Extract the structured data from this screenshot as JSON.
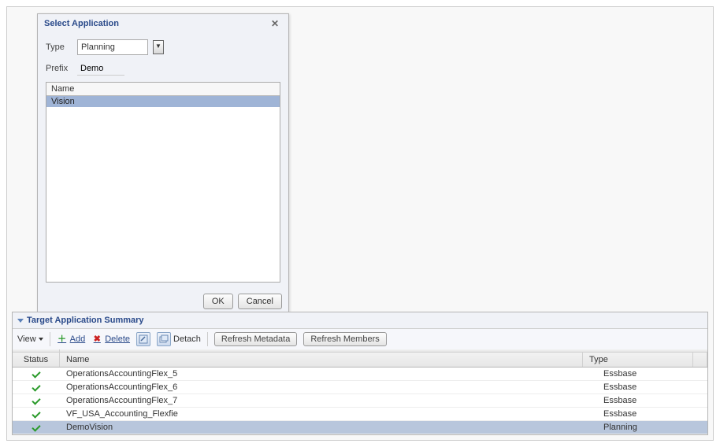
{
  "dialog": {
    "title": "Select Application",
    "type_label": "Type",
    "type_value": "Planning",
    "prefix_label": "Prefix",
    "prefix_value": "Demo",
    "list_header": "Name",
    "items": [
      "Vision"
    ],
    "ok_label": "OK",
    "cancel_label": "Cancel"
  },
  "summary": {
    "title": "Target Application Summary",
    "toolbar": {
      "view": "View",
      "add": "Add",
      "delete": "Delete",
      "detach": "Detach",
      "refresh_metadata": "Refresh Metadata",
      "refresh_members": "Refresh Members"
    },
    "columns": {
      "status": "Status",
      "name": "Name",
      "type": "Type"
    },
    "rows": [
      {
        "name": "OperationsAccountingFlex_5",
        "type": "Essbase",
        "selected": false
      },
      {
        "name": "OperationsAccountingFlex_6",
        "type": "Essbase",
        "selected": false
      },
      {
        "name": "OperationsAccountingFlex_7",
        "type": "Essbase",
        "selected": false
      },
      {
        "name": "VF_USA_Accounting_Flexfie",
        "type": "Essbase",
        "selected": false
      },
      {
        "name": "DemoVision",
        "type": "Planning",
        "selected": true
      }
    ]
  }
}
